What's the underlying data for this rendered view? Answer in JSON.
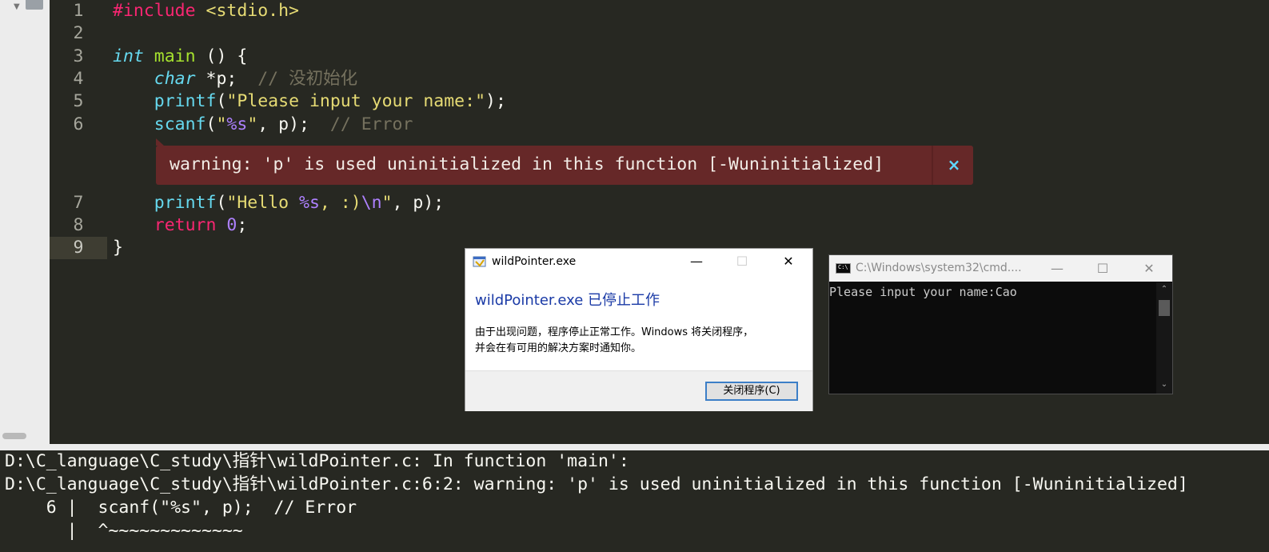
{
  "editor": {
    "lines": [
      {
        "n": "1",
        "tokens": [
          [
            "pp",
            "#include "
          ],
          [
            "hdr",
            "<stdio.h>"
          ]
        ]
      },
      {
        "n": "2",
        "tokens": []
      },
      {
        "n": "3",
        "tokens": [
          [
            "ty",
            "int"
          ],
          [
            "",
            " "
          ],
          [
            "fn",
            "main"
          ],
          [
            "",
            " () {"
          ]
        ]
      },
      {
        "n": "4",
        "tokens": [
          [
            "",
            "    "
          ],
          [
            "ty",
            "char"
          ],
          [
            "",
            " *p;  "
          ],
          [
            "cm",
            "// 没初始化"
          ]
        ]
      },
      {
        "n": "5",
        "tokens": [
          [
            "",
            "    "
          ],
          [
            "bi",
            "printf"
          ],
          [
            "",
            "("
          ],
          [
            "str",
            "\"Please input your name:\""
          ],
          [
            "",
            ");"
          ]
        ]
      },
      {
        "n": "6",
        "tokens": [
          [
            "",
            "    "
          ],
          [
            "bi",
            "scanf"
          ],
          [
            "",
            "("
          ],
          [
            "str",
            "\""
          ],
          [
            "fmt",
            "%s"
          ],
          [
            "str",
            "\""
          ],
          [
            "",
            ", p);  "
          ],
          [
            "cm",
            "// Error"
          ]
        ]
      },
      {
        "n": "7",
        "tokens": [
          [
            "",
            "    "
          ],
          [
            "bi",
            "printf"
          ],
          [
            "",
            "("
          ],
          [
            "str",
            "\"Hello "
          ],
          [
            "fmt",
            "%s"
          ],
          [
            "str",
            ", :)"
          ],
          [
            "fmt",
            "\\n"
          ],
          [
            "str",
            "\""
          ],
          [
            "",
            ", p);"
          ]
        ]
      },
      {
        "n": "8",
        "tokens": [
          [
            "",
            "    "
          ],
          [
            "kw",
            "return"
          ],
          [
            "",
            " "
          ],
          [
            "num",
            "0"
          ],
          [
            "",
            ";"
          ]
        ]
      },
      {
        "n": "9",
        "tokens": [
          [
            "",
            "}"
          ]
        ]
      }
    ],
    "warning": {
      "message": "warning: 'p' is used uninitialized in this function [-Wuninitialized]",
      "close_symbol": "×"
    }
  },
  "dialog": {
    "title": "wildPointer.exe",
    "minimize": "—",
    "maximize": "☐",
    "close": "✕",
    "heading": "wildPointer.exe 已停止工作",
    "body_line1": "由于出现问题，程序停止正常工作。Windows 将关闭程序，",
    "body_line2": "并会在有可用的解决方案时通知你。",
    "button": "关闭程序(C)"
  },
  "console": {
    "title": "C:\\Windows\\system32\\cmd....",
    "icon_text": "C:\\",
    "minimize": "—",
    "maximize": "☐",
    "close": "✕",
    "text": "Please input your name:Cao"
  },
  "output": {
    "lines": [
      "D:\\C_language\\C_study\\指针\\wildPointer.c: In function 'main':",
      "D:\\C_language\\C_study\\指针\\wildPointer.c:6:2: warning: 'p' is used uninitialized in this function [-Wuninitialized]",
      "    6 |  scanf(\"%s\", p);  // Error",
      "      |  ^~~~~~~~~~~~~~"
    ]
  }
}
